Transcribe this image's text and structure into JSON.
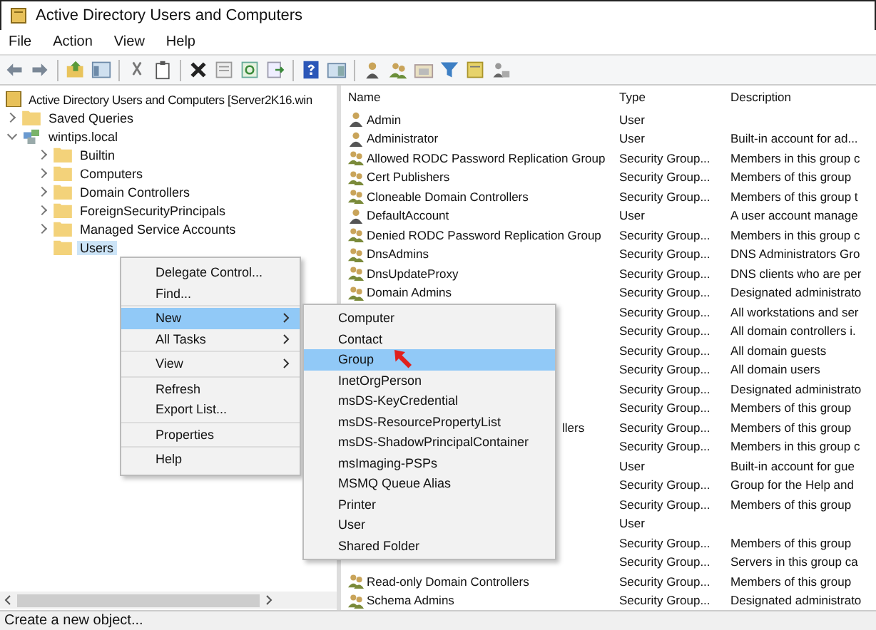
{
  "window": {
    "title": "Active Directory Users and Computers"
  },
  "menu_bar": [
    "File",
    "Action",
    "View",
    "Help"
  ],
  "tree": {
    "root": "Active Directory Users and Computers [Server2K16.win",
    "items": [
      {
        "label": "Saved Queries",
        "expanded": false,
        "selected": false
      },
      {
        "label": "wintips.local",
        "expanded": true,
        "selected": false,
        "children": [
          {
            "label": "Builtin",
            "expanded": false,
            "selected": false
          },
          {
            "label": "Computers",
            "expanded": false,
            "selected": false
          },
          {
            "label": "Domain Controllers",
            "expanded": false,
            "selected": false
          },
          {
            "label": "ForeignSecurityPrincipals",
            "expanded": false,
            "selected": false
          },
          {
            "label": "Managed Service Accounts",
            "expanded": false,
            "selected": false
          },
          {
            "label": "Users",
            "selected": true
          }
        ]
      }
    ]
  },
  "list": {
    "columns": [
      "Name",
      "Type",
      "Description"
    ],
    "rows": [
      {
        "name": "Admin",
        "kind": "user",
        "type": "User"
      },
      {
        "name": "Administrator",
        "kind": "user",
        "type": "User",
        "description": "Built-in account for ad..."
      },
      {
        "name": "Allowed RODC Password Replication Group",
        "kind": "group",
        "type": "Security Group...",
        "description": "Members in this group c"
      },
      {
        "name": "Cert Publishers",
        "kind": "group",
        "type": "Security Group...",
        "description": "Members of this group"
      },
      {
        "name": "Cloneable Domain Controllers",
        "kind": "group",
        "type": "Security Group...",
        "description": "Members of this group t"
      },
      {
        "name": "DefaultAccount",
        "kind": "user",
        "type": "User",
        "description": "A user account manage"
      },
      {
        "name": "Denied RODC Password Replication Group",
        "kind": "group",
        "type": "Security Group...",
        "description": "Members in this group c"
      },
      {
        "name": "DnsAdmins",
        "kind": "group",
        "type": "Security Group...",
        "description": "DNS Administrators Gro"
      },
      {
        "name": "DnsUpdateProxy",
        "kind": "group",
        "type": "Security Group...",
        "description": "DNS clients who are per"
      },
      {
        "name": "Domain Admins",
        "kind": "group",
        "type": "Security Group...",
        "description": "Designated administrato"
      },
      {
        "type": "Security Group...",
        "description": "All workstations and ser"
      },
      {
        "type": "Security Group...",
        "description": "All domain controllers i."
      },
      {
        "type": "Security Group...",
        "description": "All domain guests"
      },
      {
        "type": "Security Group...",
        "description": "All domain users"
      },
      {
        "type": "Security Group...",
        "description": "Designated administrato"
      },
      {
        "type": "Security Group...",
        "description": "Members of this group"
      },
      {
        "name_tail": "llers",
        "type": "Security Group...",
        "description": "Members of this group"
      },
      {
        "type": "Security Group...",
        "description": "Members in this group c"
      },
      {
        "type": "User",
        "description": "Built-in account for gue"
      },
      {
        "type": "Security Group...",
        "description": "Group for the Help and"
      },
      {
        "type": "Security Group...",
        "description": "Members of this group"
      },
      {
        "type": "User"
      },
      {
        "type": "Security Group...",
        "description": "Members of this group"
      },
      {
        "type": "Security Group...",
        "description": "Servers in this group ca"
      },
      {
        "name": "Read-only Domain Controllers",
        "kind": "group",
        "type": "Security Group...",
        "description": "Members of this group"
      },
      {
        "name": "Schema Admins",
        "kind": "group",
        "type": "Security Group...",
        "description": "Designated administrato"
      }
    ]
  },
  "context_menu": {
    "groups": [
      [
        {
          "label": "Delegate Control...",
          "submenu": false,
          "selected": false
        },
        {
          "label": "Find...",
          "submenu": false,
          "selected": false
        }
      ],
      [
        {
          "label": "New",
          "submenu": true,
          "selected": true
        },
        {
          "label": "All Tasks",
          "submenu": true,
          "selected": false
        }
      ],
      [
        {
          "label": "View",
          "submenu": true,
          "selected": false
        }
      ],
      [
        {
          "label": "Refresh",
          "submenu": false,
          "selected": false
        },
        {
          "label": "Export List...",
          "submenu": false,
          "selected": false
        }
      ],
      [
        {
          "label": "Properties",
          "submenu": false,
          "selected": false
        }
      ],
      [
        {
          "label": "Help",
          "submenu": false,
          "selected": false
        }
      ]
    ]
  },
  "submenu": {
    "items": [
      {
        "label": "Computer",
        "selected": false
      },
      {
        "label": "Contact",
        "selected": false
      },
      {
        "label": "Group",
        "selected": true
      },
      {
        "label": "InetOrgPerson",
        "selected": false
      },
      {
        "label": "msDS-KeyCredential",
        "selected": false
      },
      {
        "label": "msDS-ResourcePropertyList",
        "selected": false
      },
      {
        "label": "msDS-ShadowPrincipalContainer",
        "selected": false
      },
      {
        "label": "msImaging-PSPs",
        "selected": false
      },
      {
        "label": "MSMQ Queue Alias",
        "selected": false
      },
      {
        "label": "Printer",
        "selected": false
      },
      {
        "label": "User",
        "selected": false
      },
      {
        "label": "Shared Folder",
        "selected": false
      }
    ]
  },
  "status_bar": "Create a new object..."
}
